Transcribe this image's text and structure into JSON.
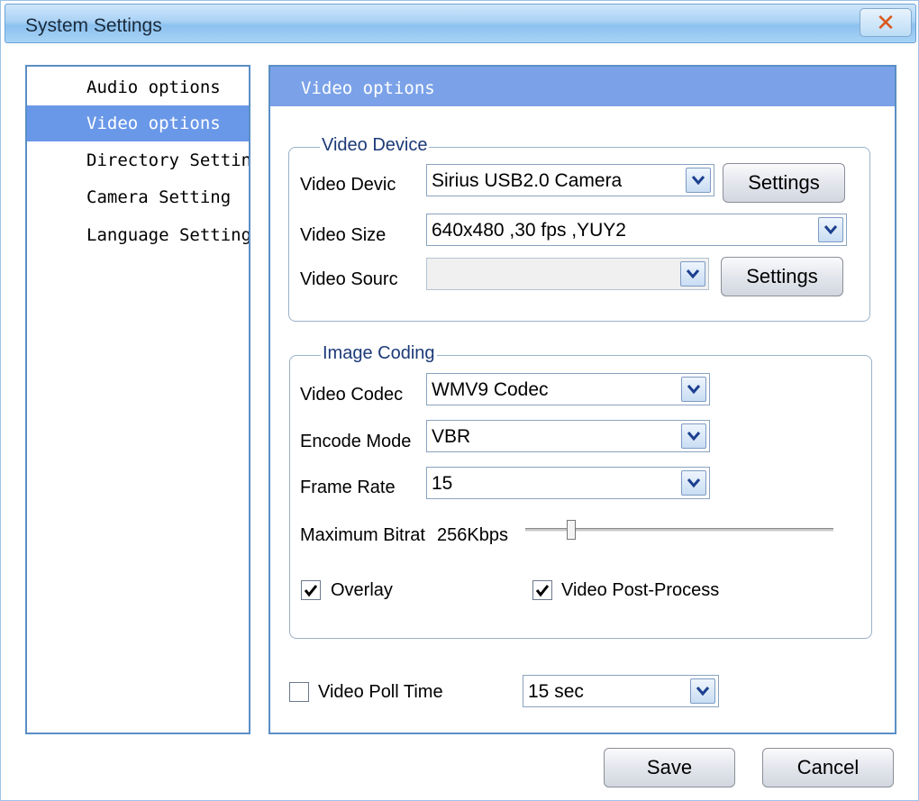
{
  "window": {
    "title": "System Settings",
    "close_glyph": "✕"
  },
  "sidebar": {
    "items": [
      {
        "label": "Audio options",
        "active": false
      },
      {
        "label": "Video options",
        "active": true
      },
      {
        "label": "Directory Settin",
        "active": false
      },
      {
        "label": "Camera Setting",
        "active": false
      },
      {
        "label": "Language Setting",
        "active": false
      }
    ]
  },
  "panel": {
    "header": "Video options",
    "video_device_group": {
      "title": "Video Device",
      "device_label": "Video Devic",
      "device_value": "Sirius USB2.0 Camera",
      "device_settings_label": "Settings",
      "size_label": "Video Size",
      "size_value": "640x480 ,30 fps ,YUY2",
      "source_label": "Video Sourc",
      "source_value": "",
      "source_settings_label": "Settings"
    },
    "image_coding_group": {
      "title": "Image Coding",
      "codec_label": "Video Codec",
      "codec_value": "WMV9 Codec",
      "encode_label": "Encode Mode",
      "encode_value": "VBR",
      "framerate_label": "Frame Rate",
      "framerate_value": "15",
      "bitrate_label": "Maximum Bitrat",
      "bitrate_value": "256Kbps",
      "bitrate_slider_fraction": 0.15,
      "overlay_label": "Overlay",
      "overlay_checked": true,
      "postprocess_label": "Video Post-Process",
      "postprocess_checked": true
    },
    "poll": {
      "label": "Video Poll Time",
      "checked": false,
      "value": "15 sec"
    }
  },
  "footer": {
    "save_label": "Save",
    "cancel_label": "Cancel"
  },
  "colors": {
    "accent": "#7ba2e8",
    "selection": "#6a98e8",
    "border": "#5a8fc5"
  },
  "icons": {
    "dropdown": "chevron-down-icon",
    "check": "checkmark-icon",
    "close": "close-icon"
  }
}
